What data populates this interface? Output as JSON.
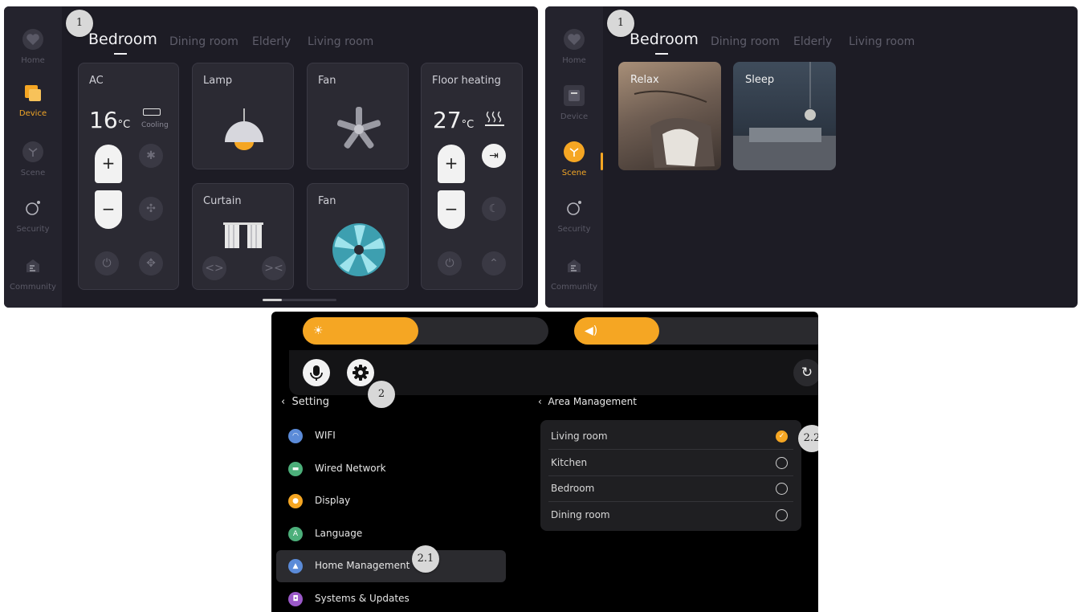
{
  "panel_device": {
    "badge": "1",
    "sidebar": [
      {
        "label": "Home",
        "icon": "heart-icon"
      },
      {
        "label": "Device",
        "icon": "device-icon",
        "active": true
      },
      {
        "label": "Scene",
        "icon": "scene-icon"
      },
      {
        "label": "Security",
        "icon": "security-icon"
      },
      {
        "label": "Community",
        "icon": "community-icon"
      }
    ],
    "tabs": [
      "Bedroom",
      "Dining room",
      "Elderly",
      "Living room"
    ],
    "active_tab": "Bedroom",
    "ac": {
      "title": "AC",
      "temp": "16",
      "unit": "°C",
      "mode": "Cooling",
      "plus": "+",
      "minus": "−"
    },
    "lamp": {
      "title": "Lamp"
    },
    "fan1": {
      "title": "Fan"
    },
    "curtain": {
      "title": "Curtain",
      "open": "<>",
      "close": "><"
    },
    "fan2": {
      "title": "Fan"
    },
    "floor_heating": {
      "title": "Floor heating",
      "temp": "27",
      "unit": "°C",
      "plus": "+",
      "minus": "−"
    }
  },
  "panel_scene": {
    "badge": "1",
    "sidebar": [
      {
        "label": "Home",
        "icon": "heart-icon"
      },
      {
        "label": "Device",
        "icon": "device-icon"
      },
      {
        "label": "Scene",
        "icon": "scene-icon",
        "active": true
      },
      {
        "label": "Security",
        "icon": "security-icon"
      },
      {
        "label": "Community",
        "icon": "community-icon"
      }
    ],
    "tabs": [
      "Bedroom",
      "Dining room",
      "Elderly",
      "Living room"
    ],
    "active_tab": "Bedroom",
    "scenes": [
      {
        "label": "Relax"
      },
      {
        "label": "Sleep"
      }
    ]
  },
  "panel_settings": {
    "brightness_level": 0.47,
    "volume_level": 0.35,
    "badge_settings": "2",
    "badge_home": "2.1",
    "badge_area": "2.2",
    "setting_header": "Setting",
    "menu": [
      {
        "label": "WIFI",
        "color": "#5b8bd8",
        "icon": "wifi-icon"
      },
      {
        "label": "Wired Network",
        "color": "#4caf7a",
        "icon": "network-icon"
      },
      {
        "label": "Display",
        "color": "#f5a623",
        "icon": "display-icon"
      },
      {
        "label": "Language",
        "color": "#4caf7a",
        "icon": "language-icon",
        "glyph": "A"
      },
      {
        "label": "Home Management",
        "color": "#5b8bd8",
        "icon": "home-icon",
        "selected": true
      },
      {
        "label": "Systems & Updates",
        "color": "#9b59c9",
        "icon": "system-icon"
      }
    ],
    "area_header": "Area Management",
    "areas": [
      {
        "label": "Living room",
        "checked": true
      },
      {
        "label": "Kitchen",
        "checked": false
      },
      {
        "label": "Bedroom",
        "checked": false
      },
      {
        "label": "Dining room",
        "checked": false
      }
    ]
  },
  "colors": {
    "accent": "#f5a623",
    "panel_bg": "#1d1c25",
    "card_bg": "#2b2a33",
    "settings_bg": "#000000"
  }
}
